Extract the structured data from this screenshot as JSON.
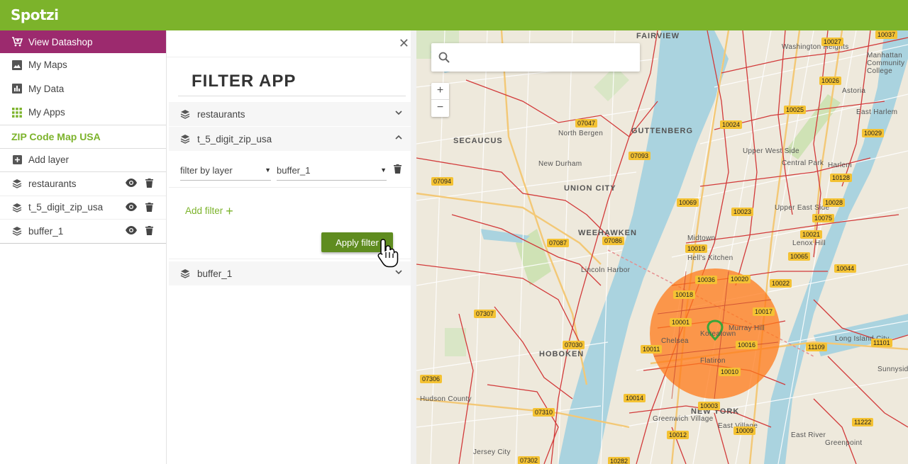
{
  "app": {
    "logo": "Spotzi"
  },
  "sidebar": {
    "datashop_label": "View Datashop",
    "nav": [
      {
        "label": "My Maps",
        "icon": "maps-icon"
      },
      {
        "label": "My Data",
        "icon": "chart-icon"
      },
      {
        "label": "My Apps",
        "icon": "apps-grid-icon"
      }
    ],
    "map_title": "ZIP Code Map USA",
    "add_layer_label": "Add layer",
    "layers": [
      {
        "label": "restaurants"
      },
      {
        "label": "t_5_digit_zip_usa"
      },
      {
        "label": "buffer_1"
      }
    ]
  },
  "filter_panel": {
    "title": "FILTER APP",
    "accordions": [
      {
        "label": "restaurants",
        "state": "collapsed"
      },
      {
        "label": "t_5_digit_zip_usa",
        "state": "expanded"
      },
      {
        "label": "buffer_1",
        "state": "collapsed"
      }
    ],
    "filter_by_placeholder": "filter by layer",
    "filter_layer_value": "buffer_1",
    "add_filter_label": "Add filter",
    "apply_label": "Apply filter"
  },
  "map": {
    "search_placeholder": "",
    "zoom_in": "+",
    "zoom_out": "−",
    "places": [
      "FAIRVIEW",
      "Washington Heights",
      "Manhattan Community College",
      "SECAUCUS",
      "GUTTENBERG",
      "North Bergen",
      "Upper West Side",
      "East Harlem",
      "New Durham",
      "UNION CITY",
      "Central Park",
      "Harlem",
      "WEEHAWKEN",
      "Lincoln Harbor",
      "Midtown",
      "Hell's Kitchen",
      "Upper East Side",
      "Lenox Hill",
      "Koreatown",
      "Murray Hill",
      "Chelsea",
      "HOBOKEN",
      "Flatiron",
      "Long Island City",
      "Sunnyside",
      "NEW YORK",
      "Greenwich Village",
      "East Village",
      "East River",
      "Greenpoint",
      "Hudson County",
      "Jersey City",
      "Astoria"
    ],
    "zips": [
      "10037",
      "10027",
      "10026",
      "10025",
      "10024",
      "10029",
      "07047",
      "07093",
      "07094",
      "10128",
      "10028",
      "10069",
      "10023",
      "10075",
      "10021",
      "10065",
      "10019",
      "07087",
      "07086",
      "10036",
      "10020",
      "10044",
      "10022",
      "10018",
      "10017",
      "10001",
      "10016",
      "11109",
      "11101",
      "10011",
      "10010",
      "07307",
      "07030",
      "07306",
      "10014",
      "10003",
      "07310",
      "10012",
      "10009",
      "11222",
      "07302",
      "10282"
    ]
  }
}
